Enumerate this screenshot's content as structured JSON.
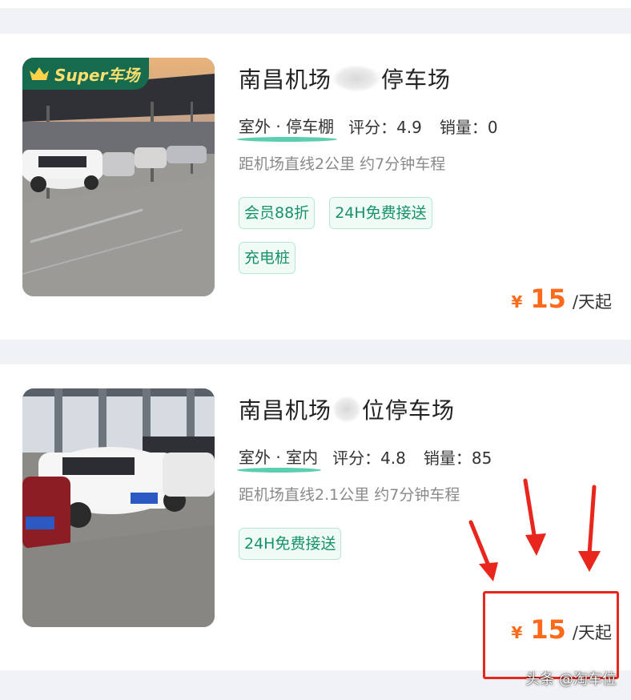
{
  "listings": [
    {
      "badge": "Super车场",
      "title_start": "南昌机场",
      "title_end": "停车场",
      "type": "室外 · 停车棚",
      "rating": "评分：4.9",
      "sales": "销量：0",
      "distance": "距机场直线2公里 约7分钟车程",
      "tags": [
        "会员88折",
        "24H免费接送",
        "充电桩"
      ],
      "price_symbol": "¥",
      "price": "15",
      "price_unit": "/天起"
    },
    {
      "title_start": "南昌机场",
      "title_end": "位停车场",
      "type": "室外 · 室内",
      "rating": "评分：4.8",
      "sales": "销量：85",
      "distance": "距机场直线2.1公里 约7分钟车程",
      "tags": [
        "24H免费接送"
      ],
      "price_symbol": "¥",
      "price": "15",
      "price_unit": "/天起"
    }
  ],
  "watermark": "头条 @淘车位",
  "colors": {
    "accent_green": "#17916b",
    "price_orange": "#ff6a1a",
    "highlight_red": "#e8261d",
    "badge_bg": "#166a4e",
    "badge_text": "#ffdf6e"
  },
  "icons": [
    "crown-icon",
    "red-arrow-icon"
  ]
}
